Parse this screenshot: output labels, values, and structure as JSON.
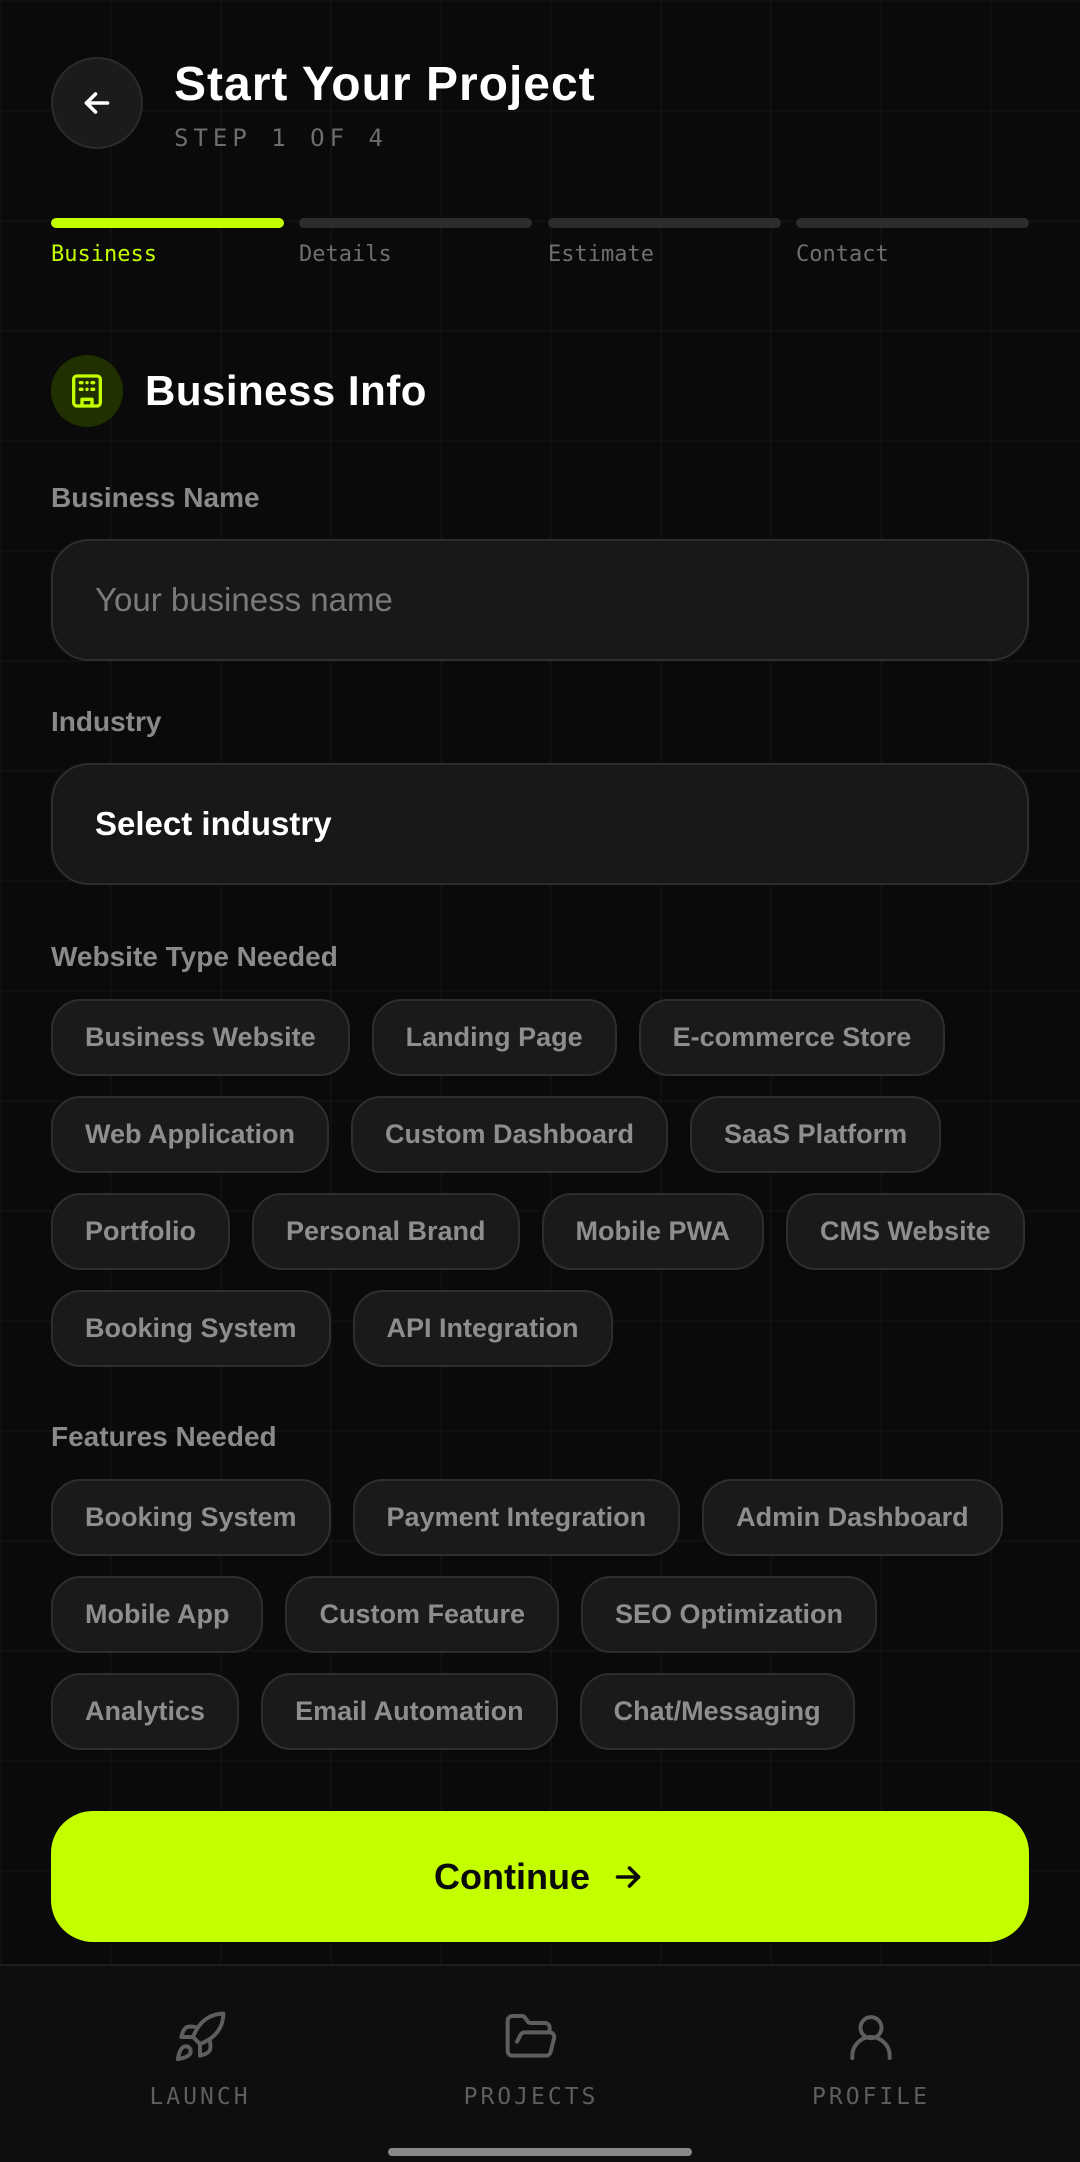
{
  "header": {
    "title": "Start Your Project",
    "step": "STEP 1 OF 4"
  },
  "progress": {
    "steps": [
      "Business",
      "Details",
      "Estimate",
      "Contact"
    ],
    "active_index": 0
  },
  "section": {
    "title": "Business Info",
    "icon": "building-icon"
  },
  "form": {
    "business_name": {
      "label": "Business Name",
      "value": "",
      "placeholder": "Your business name"
    },
    "industry": {
      "label": "Industry",
      "value": "Select industry"
    },
    "website_type": {
      "label": "Website Type Needed",
      "options": [
        "Business Website",
        "Landing Page",
        "E-commerce Store",
        "Web Application",
        "Custom Dashboard",
        "SaaS Platform",
        "Portfolio",
        "Personal Brand",
        "Mobile PWA",
        "CMS Website",
        "Booking System",
        "API Integration"
      ]
    },
    "features": {
      "label": "Features Needed",
      "options": [
        "Booking System",
        "Payment Integration",
        "Admin Dashboard",
        "Mobile App",
        "Custom Feature",
        "SEO Optimization",
        "Analytics",
        "Email Automation",
        "Chat/Messaging"
      ]
    }
  },
  "continue_label": "Continue",
  "bottom_nav": {
    "items": [
      {
        "label": "LAUNCH",
        "icon": "rocket-icon"
      },
      {
        "label": "PROJECTS",
        "icon": "folder-icon"
      },
      {
        "label": "PROFILE",
        "icon": "user-icon"
      }
    ]
  },
  "colors": {
    "accent": "#c4ff00",
    "background": "#0a0a0a",
    "chip_bg": "#1a1a1a",
    "muted_text": "#8a8a8a"
  }
}
